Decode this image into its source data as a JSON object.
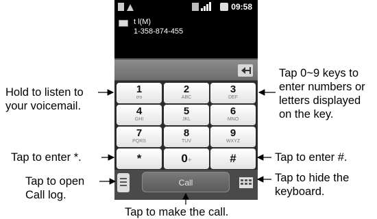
{
  "status_bar": {
    "time": "09:58"
  },
  "contact": {
    "name": "t l(M)",
    "number": "1-358-874-455"
  },
  "keys": [
    {
      "digit": "1",
      "letters": "ơo"
    },
    {
      "digit": "2",
      "letters": "ABC"
    },
    {
      "digit": "3",
      "letters": "DEF"
    },
    {
      "digit": "4",
      "letters": "GHI"
    },
    {
      "digit": "5",
      "letters": "JKL"
    },
    {
      "digit": "6",
      "letters": "MNO"
    },
    {
      "digit": "7",
      "letters": "PQRS"
    },
    {
      "digit": "8",
      "letters": "TUV"
    },
    {
      "digit": "9",
      "letters": "WXYZ"
    },
    {
      "digit": "*",
      "letters": ""
    },
    {
      "digit": "0",
      "letters": "+"
    },
    {
      "digit": "#",
      "letters": ""
    }
  ],
  "call_button": "Call",
  "annotations": {
    "voicemail_1": "Hold to listen to",
    "voicemail_2": "your voicemail.",
    "star": "Tap to enter *.",
    "calllog_1": "Tap to open",
    "calllog_2": "Call log.",
    "keys_1": "Tap 0~9 keys to",
    "keys_2": "enter numbers or",
    "keys_3": "letters displayed",
    "keys_4": "on the key.",
    "hash": "Tap to enter #.",
    "hidekb_1": "Tap to hide the",
    "hidekb_2": "keyboard.",
    "call": "Tap to make the call."
  }
}
